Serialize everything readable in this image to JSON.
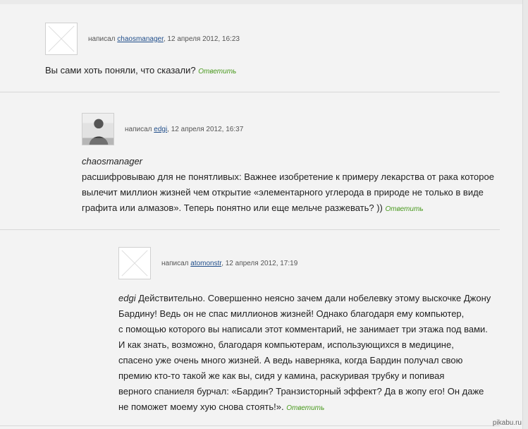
{
  "comments": [
    {
      "written_label": "написал",
      "author": "chaosmanager",
      "date": ", 12 апреля 2012, 16:23",
      "text": "Вы сами хоть поняли, что сказали?",
      "reply_label": "Ответить"
    },
    {
      "written_label": "написал",
      "author": "edgi",
      "date": ", 12 апреля 2012, 16:37",
      "quote_author": "chaosmanager",
      "lines": [
        "расшифровываю для не понятливых: Важнее изобретение к примеру лекарства от рака которое",
        "вылечит миллион жизней чем открытие «элементарного углерода в природе не только в виде",
        "графита или алмазов». Теперь понятно или еще мельче разжевать? ))"
      ],
      "reply_label": "Ответить"
    },
    {
      "written_label": "написал",
      "author": "atomonstr",
      "date": ", 12 апреля 2012, 17:19",
      "quote_author": "edgi",
      "lines": [
        "Действительно. Совершенно неясно зачем дали нобелевку этому выскочке Джону",
        "Бардину! Ведь он не спас миллионов жизней! Однако благодаря ему компьютер,",
        "с помощью которого вы написали этот комментарий, не занимает три этажа под вами.",
        "И как знать, возможно, благодаря компьютерам, использующихся в медицине,",
        "спасено уже очень много жизней. А ведь наверняка, когда Бардин получал свою",
        "премию кто-то такой же как вы, сидя у камина, раскуривая трубку и попивая",
        "верного спаниеля бурчал: «Бардин? Транзисторный эффект? Да в жопу его! Он даже",
        "не поможет моему хую снова стоять!»."
      ],
      "reply_label": "Ответить"
    }
  ],
  "watermark": "pikabu.ru",
  "colors": {
    "background": "#f3f3f3",
    "link": "#1f4d8a",
    "reply": "#4a9a1f",
    "divider": "#d8d8d8"
  }
}
